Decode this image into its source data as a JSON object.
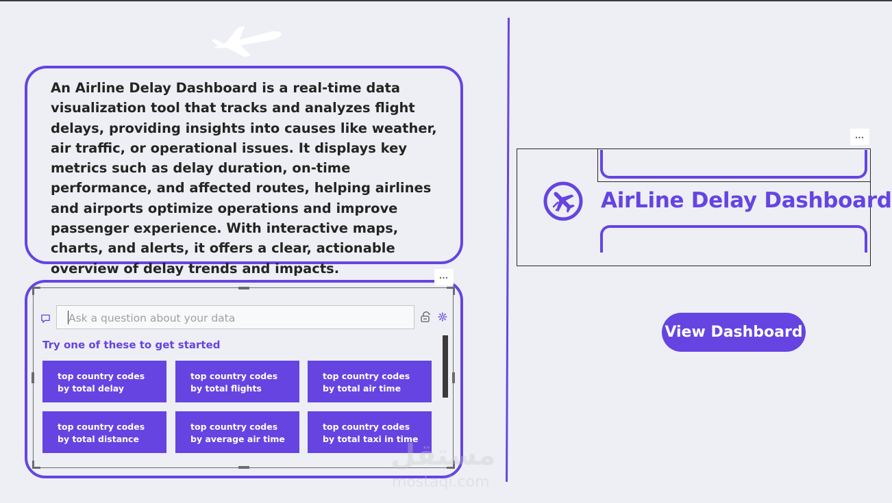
{
  "description": {
    "text": "An Airline Delay Dashboard is a real-time data visualization tool that tracks and analyzes flight delays, providing insights into causes like weather, air traffic, or operational issues. It displays key metrics such as delay duration, on-time performance, and affected routes, helping airlines and airports optimize operations and improve passenger experience. With interactive maps, charts, and alerts, it offers a clear, actionable overview of delay trends and impacts."
  },
  "qa_visual": {
    "more_label": "…",
    "input_placeholder": "Ask a question about your data",
    "try_label": "Try one of these to get started",
    "suggestions": [
      "top country codes by total delay",
      "top country codes by total flights",
      "top country codes by total air time",
      "top country codes by total distance",
      "top country codes by average air time",
      "top country codes by total taxi in time"
    ]
  },
  "title_card": {
    "more_label": "…",
    "title": "AirLine Delay Dashboard"
  },
  "view_button": {
    "label": "View Dashboard"
  },
  "watermark": {
    "arabic": "مستقل",
    "latin": "mostaql.com"
  },
  "colors": {
    "accent": "#6544e2",
    "background": "#edeff4",
    "text": "#252423"
  },
  "icons": [
    "plane-icon",
    "plane-circle-icon",
    "chat-icon",
    "share-icon",
    "settings-icon",
    "more-options-icon"
  ]
}
